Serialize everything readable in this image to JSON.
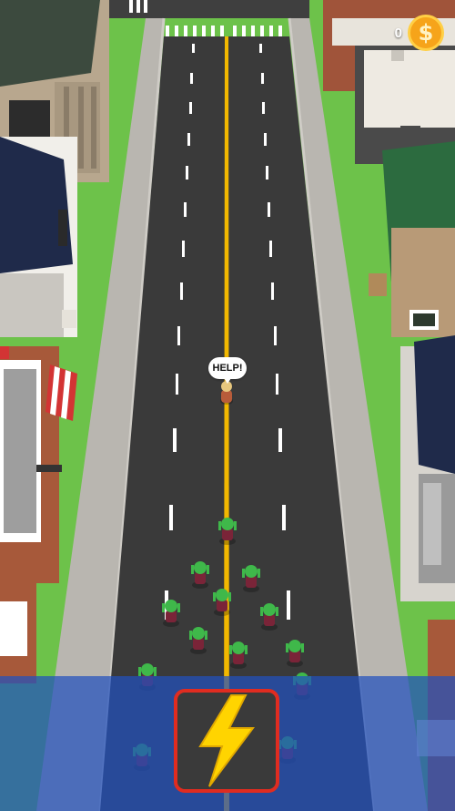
{
  "hud": {
    "coins": "0",
    "coin_icon": "dollar-coin-icon",
    "coin_symbol": "$"
  },
  "survivor": {
    "speech": "HELP!"
  },
  "powerup": {
    "icon": "lightning-bolt-icon"
  },
  "colors": {
    "road": "#3a3a3a",
    "grass": "#6dc24a",
    "center_line": "#f2b800",
    "zombie_skin": "#3fb84a",
    "zombie_shirt": "#7a2438",
    "panel": "#2150be",
    "button_border": "#e02c20",
    "bolt": "#ffd400",
    "coin": "#f6a41a"
  }
}
